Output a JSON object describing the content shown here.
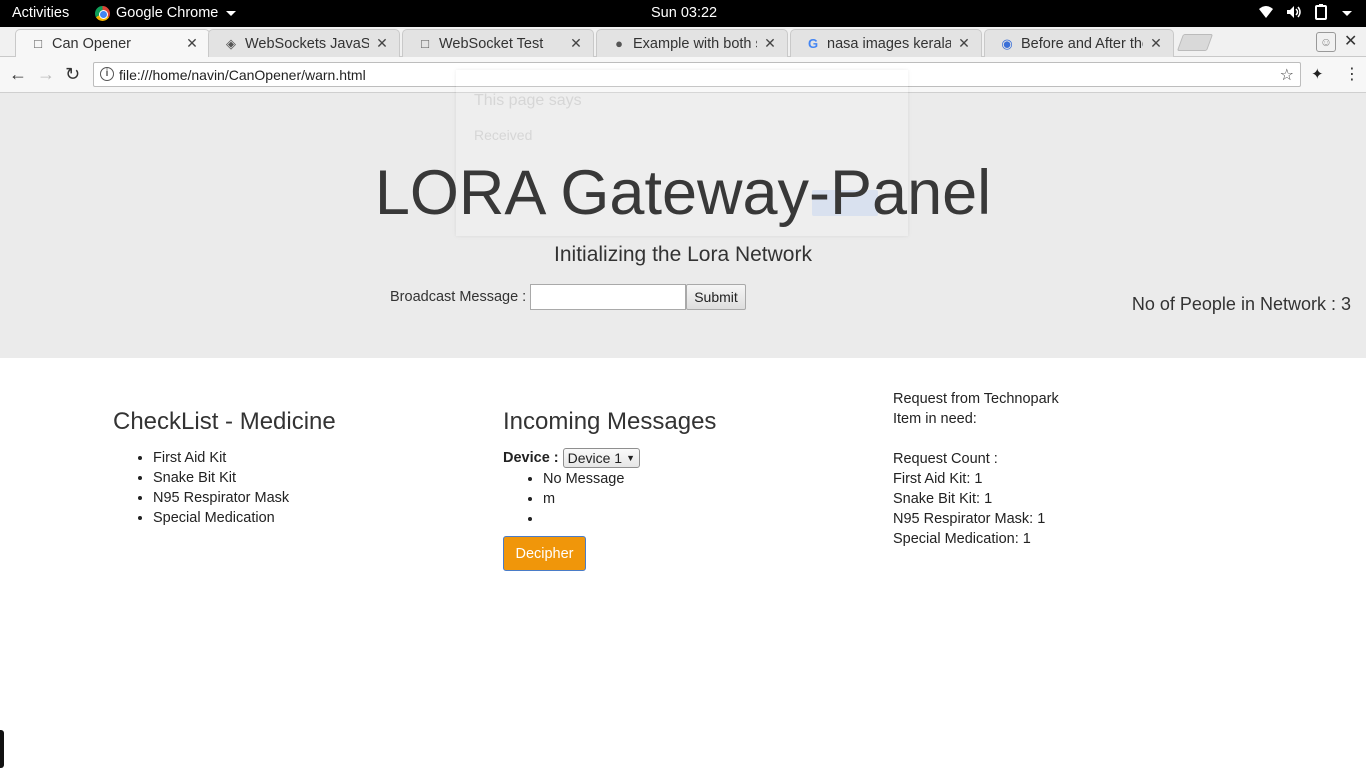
{
  "topbar": {
    "activities": "Activities",
    "app_name": "Google Chrome",
    "clock": "Sun 03:22"
  },
  "tabs": [
    {
      "title": "Can Opener",
      "icon": "page-icon",
      "active": true
    },
    {
      "title": "WebSockets JavaSc",
      "icon": "websocket-icon",
      "active": false
    },
    {
      "title": "WebSocket Test",
      "icon": "page-icon",
      "active": false
    },
    {
      "title": "Example with both s",
      "icon": "github-icon",
      "active": false
    },
    {
      "title": "nasa images kerala",
      "icon": "google-icon",
      "active": false
    },
    {
      "title": "Before and After the",
      "icon": "globe-icon",
      "active": false
    }
  ],
  "toolbar": {
    "url": "file:///home/navin/CanOpener/warn.html"
  },
  "dialog": {
    "title": "This page says",
    "message": "Received"
  },
  "hero": {
    "title": "LORA Gateway-Panel",
    "subtitle": "Initializing the Lora Network",
    "broadcast_label": "Broadcast Message :",
    "broadcast_value": "",
    "submit_label": "Submit",
    "people_count_text": "No of People in Network : 3"
  },
  "checklist": {
    "heading": "CheckList - Medicine",
    "items": [
      "First Aid Kit",
      "Snake Bit Kit",
      "N95 Respirator Mask",
      "Special Medication"
    ]
  },
  "incoming": {
    "heading": "Incoming Messages",
    "device_label": "Device :",
    "device_selected": "Device 1",
    "messages": [
      "No Message",
      "m",
      ""
    ],
    "decipher_label": "Decipher"
  },
  "requests": {
    "from": "Request from Technopark",
    "item_in_need": "Item in need:",
    "count_label": "Request Count :",
    "counts": [
      "First Aid Kit: 1",
      "Snake Bit Kit: 1",
      "N95 Respirator Mask: 1",
      "Special Medication: 1"
    ]
  },
  "colors": {
    "hero_bg": "#ebebeb",
    "decipher_bg": "#f0960a",
    "topbar_bg": "#000000"
  }
}
